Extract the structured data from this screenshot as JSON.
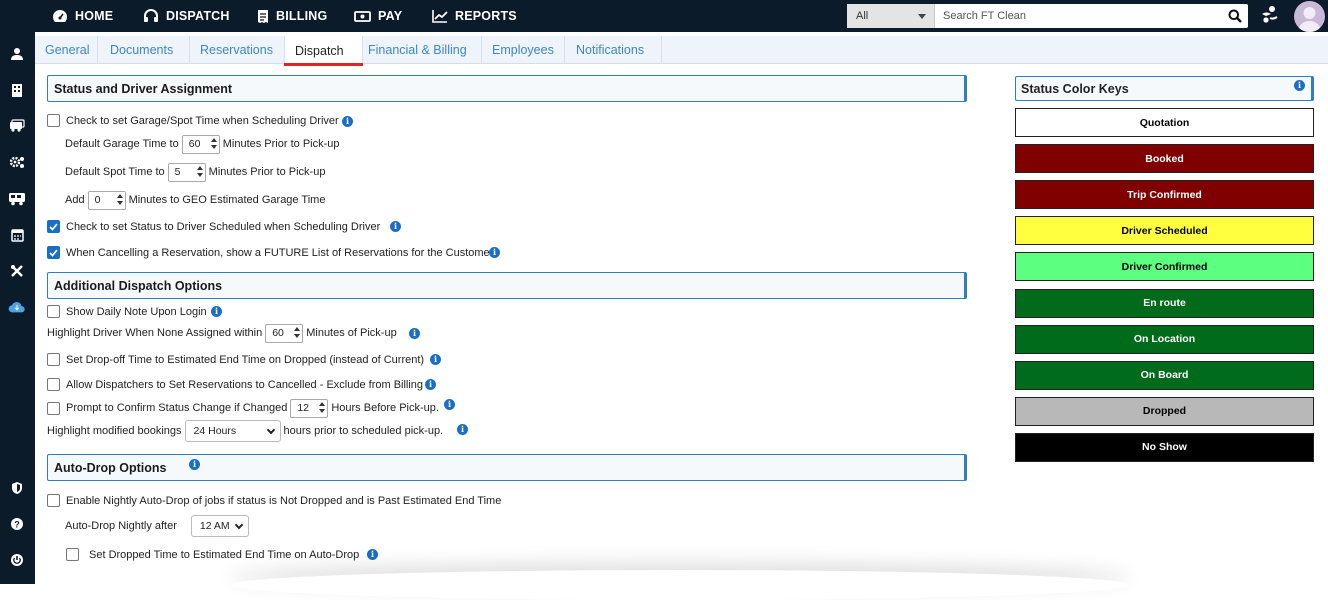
{
  "topnav": {
    "items": [
      {
        "label": "HOME",
        "icon": "gauge-icon"
      },
      {
        "label": "DISPATCH",
        "icon": "headset-icon"
      },
      {
        "label": "BILLING",
        "icon": "receipt-icon"
      },
      {
        "label": "PAY",
        "icon": "cash-icon"
      },
      {
        "label": "REPORTS",
        "icon": "trend-chart-icon"
      }
    ],
    "search": {
      "scope": "All",
      "placeholder": "Search FT Clean"
    }
  },
  "sidebar": {
    "icons": [
      "people-icon",
      "building-icon",
      "vehicles-icon",
      "settings-gears-icon",
      "bus-icon",
      "calendar-icon",
      "tools-icon",
      "cloud-icon",
      "shield-icon",
      "help-icon",
      "power-icon"
    ]
  },
  "tabs": [
    {
      "label": "General"
    },
    {
      "label": "Documents"
    },
    {
      "label": "Reservations"
    },
    {
      "label": "Dispatch",
      "active": true
    },
    {
      "label": "Financial & Billing"
    },
    {
      "label": "Employees"
    },
    {
      "label": "Notifications"
    }
  ],
  "status_driver": {
    "title": "Status and Driver Assignment",
    "garage_spot_check": "Check to set Garage/Spot Time when Scheduling Driver",
    "garage_time_label": "Default Garage Time to",
    "garage_time_value": "60",
    "garage_time_suffix": "Minutes Prior to Pick-up",
    "spot_time_label": "Default Spot Time to",
    "spot_time_value": "5",
    "spot_time_suffix": "Minutes Prior to Pick-up",
    "add_label": "Add",
    "add_value": "0",
    "add_suffix": "Minutes to GEO Estimated Garage Time",
    "status_check": "Check to set Status to Driver Scheduled when Scheduling Driver",
    "cancel_check": "When Cancelling a Reservation, show a FUTURE List of Reservations for the Customer"
  },
  "additional": {
    "title": "Additional Dispatch Options",
    "daily_note": "Show Daily Note Upon Login",
    "highlight_label": "Highlight Driver When None Assigned within",
    "highlight_value": "60",
    "highlight_suffix": "Minutes of Pick-up",
    "dropoff_check": "Set Drop-off Time to Estimated End Time on Dropped (instead of Current)",
    "allow_cancel": "Allow Dispatchers to Set Reservations to Cancelled - Exclude from Billing",
    "prompt_label": "Prompt to Confirm Status Change if Changed",
    "prompt_value": "12",
    "prompt_suffix": "Hours Before Pick-up.",
    "modified_label": "Highlight modified bookings",
    "modified_value": "24 Hours",
    "modified_suffix": "hours prior to scheduled pick-up."
  },
  "autodrop": {
    "title": "Auto-Drop Options",
    "enable_check": "Enable Nightly Auto-Drop of jobs if status is Not Dropped and is Past Estimated End Time",
    "after_label": "Auto-Drop Nightly after",
    "after_value": "12 AM",
    "dropped_time_check": "Set Dropped Time to Estimated End Time on Auto-Drop"
  },
  "color_keys": {
    "title": "Status Color Keys",
    "items": [
      {
        "label": "Quotation",
        "bg": "#ffffff",
        "fg": "#000000"
      },
      {
        "label": "Booked",
        "bg": "#800000",
        "fg": "#ffffff"
      },
      {
        "label": "Trip Confirmed",
        "bg": "#800000",
        "fg": "#ffffff"
      },
      {
        "label": "Driver Scheduled",
        "bg": "#ffff40",
        "fg": "#000000"
      },
      {
        "label": "Driver Confirmed",
        "bg": "#5cff80",
        "fg": "#000000"
      },
      {
        "label": "En route",
        "bg": "#006b1b",
        "fg": "#ffffff"
      },
      {
        "label": "On Location",
        "bg": "#006b1b",
        "fg": "#ffffff"
      },
      {
        "label": "On Board",
        "bg": "#006b1b",
        "fg": "#ffffff"
      },
      {
        "label": "Dropped",
        "bg": "#b8b8b8",
        "fg": "#000000"
      },
      {
        "label": "No Show",
        "bg": "#000000",
        "fg": "#ffffff"
      }
    ]
  },
  "colors": {
    "topbar": "#0c1b2a",
    "accent": "#1a6fc4",
    "tab_link": "#3f86c3",
    "active_underline": "#e02424"
  }
}
